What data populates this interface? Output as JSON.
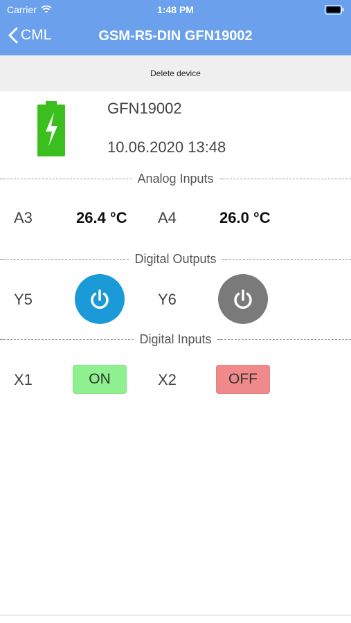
{
  "status_bar": {
    "carrier": "Carrier",
    "time": "1:48 PM"
  },
  "nav": {
    "back_label": "CML",
    "title": "GSM-R5-DIN GFN19002"
  },
  "actions": {
    "delete_label": "Delete device"
  },
  "device": {
    "id": "GFN19002",
    "timestamp": "10.06.2020 13:48",
    "battery_icon": "battery-charging-icon"
  },
  "sections": {
    "analog": "Analog Inputs",
    "digital_outputs": "Digital Outputs",
    "digital_inputs": "Digital Inputs"
  },
  "analog_inputs": [
    {
      "label": "A3",
      "value": "26.4 °C"
    },
    {
      "label": "A4",
      "value": "26.0 °C"
    }
  ],
  "digital_outputs": [
    {
      "label": "Y5",
      "state": "on",
      "color": "#1a9ad6"
    },
    {
      "label": "Y6",
      "state": "off",
      "color": "#7a7a7a"
    }
  ],
  "digital_inputs": [
    {
      "label": "X1",
      "state": "ON",
      "color": "#8ef08e"
    },
    {
      "label": "X2",
      "state": "OFF",
      "color": "#f08a8a"
    }
  ],
  "colors": {
    "nav_bg": "#6aa0ec",
    "battery_green": "#3bbf1f"
  }
}
